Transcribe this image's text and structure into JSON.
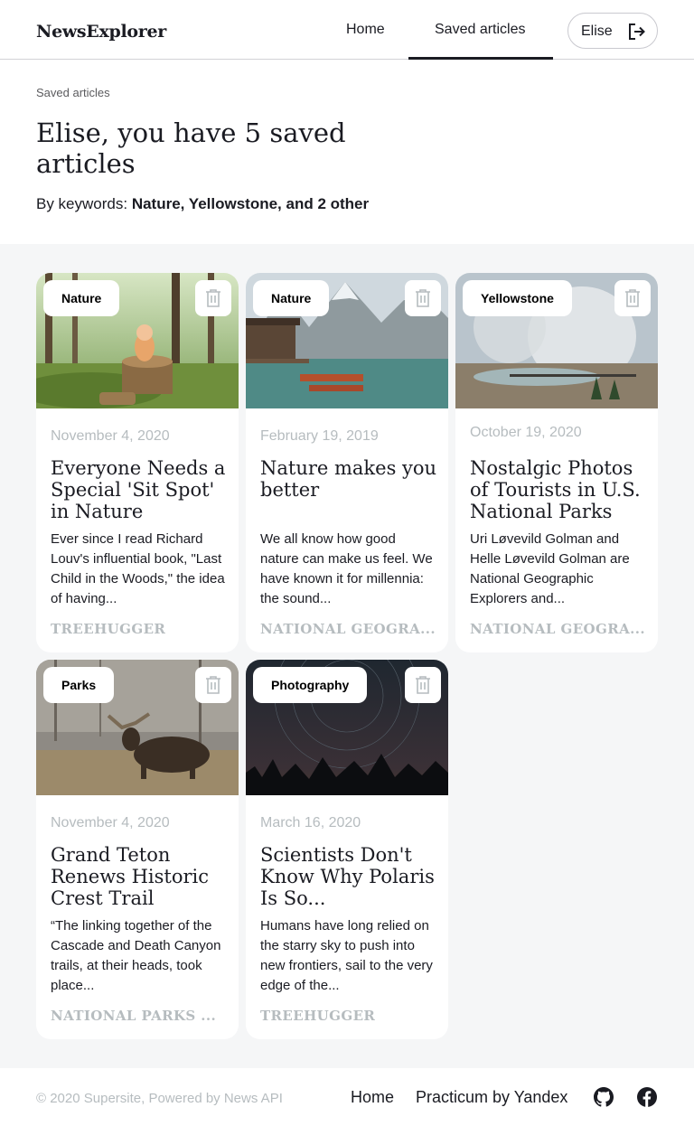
{
  "header": {
    "logo": "NewsExplorer",
    "nav": {
      "home": "Home",
      "saved": "Saved articles"
    },
    "user": {
      "name": "Elise",
      "icon": "logout-icon"
    }
  },
  "intro": {
    "label": "Saved articles",
    "title": "Elise, you have 5 saved articles",
    "keywords_prefix": "By keywords: ",
    "keywords": "Nature, Yellowstone, and 2 other"
  },
  "cards": [
    {
      "tag": "Nature",
      "date": "November 4, 2020",
      "title": "Everyone Needs a Special 'Sit Spot' in Nature",
      "text": "Ever since I read Richard Louv's influential book, \"Last Child in the Woods,\" the idea of having...",
      "source": "TREEHUGGER"
    },
    {
      "tag": "Nature",
      "date": "February 19, 2019",
      "title": "Nature makes you better",
      "text": "We all know how good nature can make us feel. We have known it for millennia: the sound...",
      "source": "NATIONAL GEOGRA..."
    },
    {
      "tag": "Yellowstone",
      "date": "October 19, 2020",
      "title": "Nostalgic Photos of Tourists in U.S. National Parks",
      "text": "Uri Løvevild Golman and Helle Løvevild Golman are National Geographic Explorers and...",
      "source": "NATIONAL GEOGRA..."
    },
    {
      "tag": "Parks",
      "date": "November 4, 2020",
      "title": "Grand Teton Renews Historic Crest Trail",
      "text": "“The linking together of the Cascade and Death Canyon trails, at their heads, took place...",
      "source": "NATIONAL PARKS ..."
    },
    {
      "tag": "Photography",
      "date": "March 16, 2020",
      "title": "Scientists Don't Know Why Polaris Is So...",
      "text": "Humans have long relied on the starry sky to push into new frontiers, sail to the very edge of the...",
      "source": "TREEHUGGER"
    }
  ],
  "footer": {
    "copyright": "© 2020 Supersite, Powered by News API",
    "links": {
      "home": "Home",
      "practicum": "Practicum by Yandex"
    },
    "icons": [
      "github-icon",
      "facebook-icon"
    ]
  }
}
